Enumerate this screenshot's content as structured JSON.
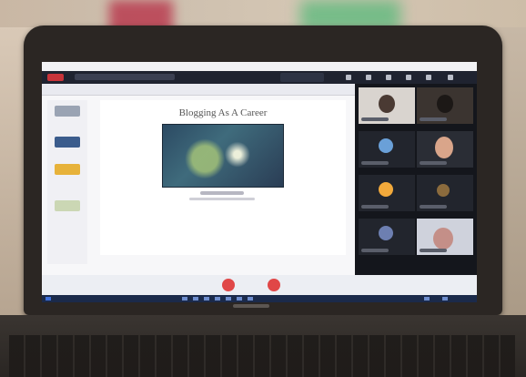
{
  "slide": {
    "title": "Blogging As A Career"
  },
  "gallery": {
    "tiles": [
      {
        "name": ""
      },
      {
        "name": ""
      },
      {
        "name": ""
      },
      {
        "name": ""
      },
      {
        "name": ""
      },
      {
        "name": ""
      },
      {
        "name": ""
      },
      {
        "name": ""
      }
    ]
  },
  "colors": {
    "zoom_topbar": "#1f2330",
    "record_red": "#c8343a",
    "control_red": "#e04747",
    "taskbar_blue": "#1b2a4a"
  }
}
